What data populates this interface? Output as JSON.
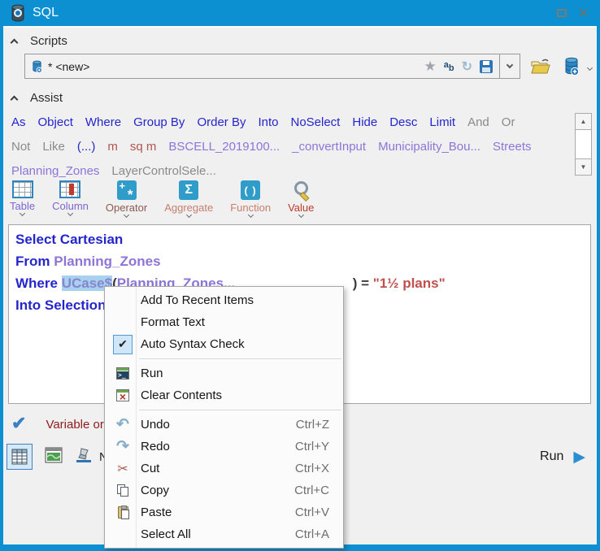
{
  "window": {
    "title": "SQL"
  },
  "colors": {
    "titlebar": "#0d90d2",
    "frame": "#0d90d2",
    "keyword_blue": "#2525cd",
    "table_purple": "#8d75d8",
    "unit_red": "#b3544e",
    "string_red": "#c0504d",
    "muted_gray": "#8a8a8a",
    "status_maroon": "#8e1b1b",
    "selection": "#a8d1f0",
    "run_play_blue": "#2a8fd0"
  },
  "icons": {
    "sql-db-icon": "(css-shape)",
    "float-icon": "(css-shape)",
    "close-icon": "×",
    "star-icon": "★",
    "rename-icon-a": "a",
    "rename-icon-b": "b",
    "refresh-icon": "↻",
    "save-icon": "(css-shape)",
    "combo-caret-icon": "(chevron-down)",
    "open-folder-icon": "(svg)",
    "db-add-icon": "(svg)",
    "scroll-up-icon": "▲",
    "scroll-down-icon": "▼",
    "undo-icon": "↶",
    "redo-icon": "↷",
    "cut-icon": "✂",
    "check-icon": "✔",
    "big-check-icon": "✔",
    "run-play-icon": "▶"
  },
  "scripts": {
    "header": "Scripts",
    "combo_value": "* <new>"
  },
  "assist": {
    "header": "Assist",
    "rows": [
      [
        {
          "t": "As",
          "c": "kw"
        },
        {
          "t": "Object",
          "c": "kw"
        },
        {
          "t": "Where",
          "c": "kw"
        },
        {
          "t": "Group By",
          "c": "kw"
        },
        {
          "t": "Order By",
          "c": "kw"
        },
        {
          "t": "Into",
          "c": "kw"
        },
        {
          "t": "NoSelect",
          "c": "kw"
        },
        {
          "t": "Hide",
          "c": "kw"
        },
        {
          "t": "Desc",
          "c": "kw"
        },
        {
          "t": "Limit",
          "c": "kw"
        },
        {
          "t": "And",
          "c": "gy"
        },
        {
          "t": "Or",
          "c": "gy"
        }
      ],
      [
        {
          "t": "Not",
          "c": "gy"
        },
        {
          "t": "Like",
          "c": "gy"
        },
        {
          "t": "(...)",
          "c": "kw"
        },
        {
          "t": "m",
          "c": "un"
        },
        {
          "t": "sq m",
          "c": "un"
        },
        {
          "t": "BSCELL_2019100...",
          "c": "tb"
        },
        {
          "t": "_convertInput",
          "c": "tb"
        },
        {
          "t": "Municipality_Bou...",
          "c": "tb"
        },
        {
          "t": "Streets",
          "c": "tb"
        }
      ],
      [
        {
          "t": "Planning_Zones",
          "c": "tb"
        },
        {
          "t": "LayerControlSele...",
          "c": "gy"
        }
      ]
    ]
  },
  "toolbar": {
    "buttons": [
      {
        "label": "Table",
        "icon": "table-icon",
        "label_color": "#7d66cf"
      },
      {
        "label": "Column",
        "icon": "column-icon",
        "label_color": "#7d66cf"
      },
      {
        "label": "Operator",
        "icon": "operator-icon",
        "label_color": "#8d5a52"
      },
      {
        "label": "Aggregate",
        "icon": "aggregate-icon",
        "label_color": "#c77e6e"
      },
      {
        "label": "Function",
        "icon": "function-icon",
        "label_color": "#c77e6e"
      },
      {
        "label": "Value",
        "icon": "value-icon",
        "label_color": "#c0392b"
      }
    ]
  },
  "editor": {
    "lines": [
      [
        {
          "t": "Select Cartesian",
          "c": "ed-kw"
        }
      ],
      [
        {
          "t": "From ",
          "c": "ed-kw"
        },
        {
          "t": "Planning_Zones",
          "c": "ed-tbl"
        }
      ],
      [
        {
          "t": "Where ",
          "c": "ed-kw"
        },
        {
          "t": "UCase$",
          "c": "ed-fn ed-sel"
        },
        {
          "t": "(",
          "c": "ed-plain"
        },
        {
          "t": "Planning_Zones...",
          "c": "ed-tbl ed-mid"
        },
        {
          "t": ") = ",
          "c": "ed-plain"
        },
        {
          "t": "\"1½ plans\"",
          "c": "ed-str"
        }
      ],
      [
        {
          "t": "Into Selection",
          "c": "ed-kw"
        }
      ]
    ]
  },
  "status": {
    "message": "Variable or"
  },
  "bottom": {
    "partial_label": "No",
    "run_label": "Run"
  },
  "menu": {
    "items": [
      {
        "label": "Add To Recent Items"
      },
      {
        "label": "Format Text"
      },
      {
        "label": "Auto Syntax Check",
        "checked": true
      },
      {
        "separator": true
      },
      {
        "label": "Run",
        "icon": "run-console-icon"
      },
      {
        "label": "Clear Contents",
        "icon": "clear-contents-icon"
      },
      {
        "separator": true
      },
      {
        "label": "Undo",
        "shortcut": "Ctrl+Z",
        "icon": "undo-icon"
      },
      {
        "label": "Redo",
        "shortcut": "Ctrl+Y",
        "icon": "redo-icon"
      },
      {
        "label": "Cut",
        "shortcut": "Ctrl+X",
        "icon": "cut-icon"
      },
      {
        "label": "Copy",
        "shortcut": "Ctrl+C",
        "icon": "copy-icon"
      },
      {
        "label": "Paste",
        "shortcut": "Ctrl+V",
        "icon": "paste-icon"
      },
      {
        "label": "Select All",
        "shortcut": "Ctrl+A"
      }
    ]
  }
}
